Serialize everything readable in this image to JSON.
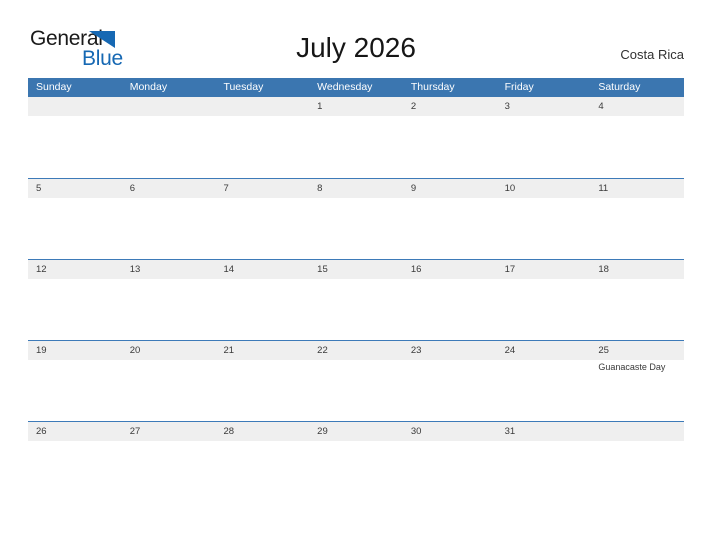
{
  "brand": {
    "line1": "General",
    "line2": "Blue",
    "triangle_color": "#1668b3",
    "text_color": "#1a1a1a"
  },
  "header": {
    "title": "July 2026",
    "country": "Costa Rica"
  },
  "calendar": {
    "header_bg": "#3b76b0",
    "row_line_color": "#3d7ab8",
    "band_bg": "#efefef",
    "weekdays": [
      "Sunday",
      "Monday",
      "Tuesday",
      "Wednesday",
      "Thursday",
      "Friday",
      "Saturday"
    ],
    "weeks": [
      {
        "days": [
          {
            "num": "",
            "events": []
          },
          {
            "num": "",
            "events": []
          },
          {
            "num": "",
            "events": []
          },
          {
            "num": "1",
            "events": []
          },
          {
            "num": "2",
            "events": []
          },
          {
            "num": "3",
            "events": []
          },
          {
            "num": "4",
            "events": []
          }
        ]
      },
      {
        "days": [
          {
            "num": "5",
            "events": []
          },
          {
            "num": "6",
            "events": []
          },
          {
            "num": "7",
            "events": []
          },
          {
            "num": "8",
            "events": []
          },
          {
            "num": "9",
            "events": []
          },
          {
            "num": "10",
            "events": []
          },
          {
            "num": "11",
            "events": []
          }
        ]
      },
      {
        "days": [
          {
            "num": "12",
            "events": []
          },
          {
            "num": "13",
            "events": []
          },
          {
            "num": "14",
            "events": []
          },
          {
            "num": "15",
            "events": []
          },
          {
            "num": "16",
            "events": []
          },
          {
            "num": "17",
            "events": []
          },
          {
            "num": "18",
            "events": []
          }
        ]
      },
      {
        "days": [
          {
            "num": "19",
            "events": []
          },
          {
            "num": "20",
            "events": []
          },
          {
            "num": "21",
            "events": []
          },
          {
            "num": "22",
            "events": []
          },
          {
            "num": "23",
            "events": []
          },
          {
            "num": "24",
            "events": []
          },
          {
            "num": "25",
            "events": [
              "Guanacaste Day"
            ]
          }
        ]
      },
      {
        "days": [
          {
            "num": "26",
            "events": []
          },
          {
            "num": "27",
            "events": []
          },
          {
            "num": "28",
            "events": []
          },
          {
            "num": "29",
            "events": []
          },
          {
            "num": "30",
            "events": []
          },
          {
            "num": "31",
            "events": []
          },
          {
            "num": "",
            "events": []
          }
        ]
      }
    ]
  }
}
